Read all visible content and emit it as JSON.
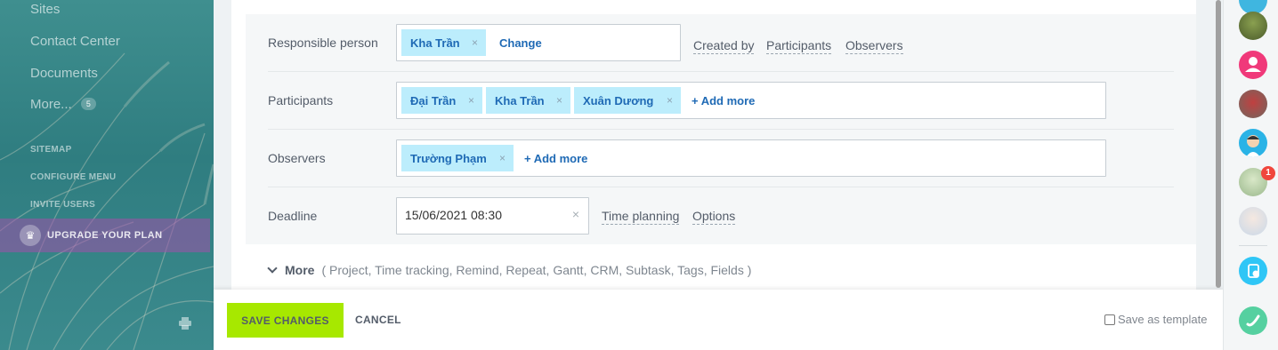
{
  "sidebar": {
    "items": [
      {
        "label": "Sites"
      },
      {
        "label": "Contact Center"
      },
      {
        "label": "Documents"
      },
      {
        "label": "More..."
      }
    ],
    "more_count": "5",
    "links": [
      "SITEMAP",
      "CONFIGURE MENU",
      "INVITE USERS"
    ],
    "upgrade_label": "UPGRADE YOUR PLAN"
  },
  "form": {
    "responsible": {
      "label": "Responsible person",
      "chips": [
        "Kha Trần"
      ],
      "change_label": "Change",
      "links": [
        "Created by",
        "Participants",
        "Observers"
      ]
    },
    "participants": {
      "label": "Participants",
      "chips": [
        "Đại Trần",
        "Kha Trần",
        "Xuân Dương"
      ],
      "add_label": "+ Add more"
    },
    "observers": {
      "label": "Observers",
      "chips": [
        "Trường Phạm"
      ],
      "add_label": "+ Add more"
    },
    "deadline": {
      "label": "Deadline",
      "value": "15/06/2021 08:30",
      "clear": "×",
      "links": [
        "Time planning",
        "Options"
      ]
    },
    "chip_remove": "×"
  },
  "more": {
    "label": "More",
    "options": "( Project,  Time tracking,  Remind,  Repeat,  Gantt,  CRM,  Subtask,  Tags,  Fields )"
  },
  "actions": {
    "save_label": "SAVE CHANGES",
    "cancel_label": "CANCEL",
    "template_label": "Save as template"
  },
  "rail": {
    "notification_count": "1"
  },
  "colors": {
    "accent_green": "#a7e800",
    "chip_bg": "#bcedfc",
    "link_blue": "#1f6ab5",
    "upgrade_purple": "#a050aa"
  }
}
